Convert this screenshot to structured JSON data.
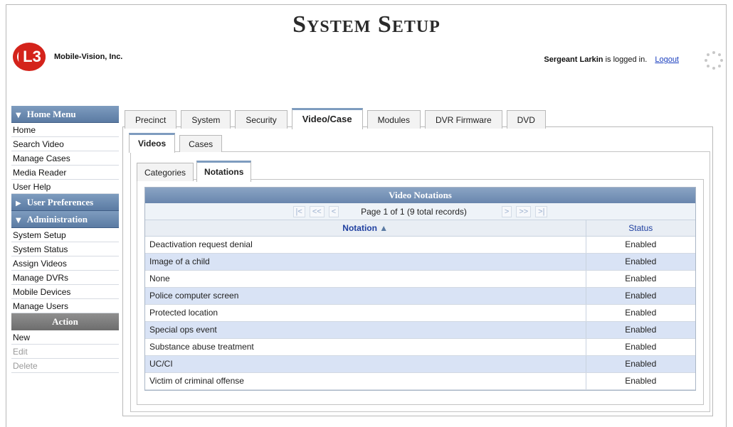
{
  "header": {
    "title": "System Setup",
    "company": "Mobile-Vision, Inc.",
    "logo_mark": "L3",
    "user_name": "Sergeant Larkin",
    "logged_in_text": "is logged in.",
    "logout_label": "Logout"
  },
  "sidebar": {
    "home_menu": {
      "header": "Home Menu",
      "items": [
        "Home",
        "Search Video",
        "Manage Cases",
        "Media Reader",
        "User Help"
      ]
    },
    "user_prefs": {
      "header": "User Preferences"
    },
    "administration": {
      "header": "Administration",
      "items": [
        "System Setup",
        "System Status",
        "Assign Videos",
        "Manage DVRs",
        "Mobile Devices",
        "Manage Users"
      ]
    },
    "action": {
      "header": "Action",
      "items": [
        {
          "label": "New",
          "enabled": true
        },
        {
          "label": "Edit",
          "enabled": false
        },
        {
          "label": "Delete",
          "enabled": false
        }
      ]
    }
  },
  "main_tabs": [
    "Precinct",
    "System",
    "Security",
    "Video/Case",
    "Modules",
    "DVR Firmware",
    "DVD"
  ],
  "main_tab_active": "Video/Case",
  "sub_tabs": [
    "Videos",
    "Cases"
  ],
  "sub_tab_active": "Videos",
  "sub_sub_tabs": [
    "Categories",
    "Notations"
  ],
  "sub_sub_tab_active": "Notations",
  "grid": {
    "title": "Video Notations",
    "pager_text": "Page 1 of 1 (9 total records)",
    "pager_first": "|<",
    "pager_prev_page": "<<",
    "pager_prev": "<",
    "pager_next": ">",
    "pager_next_page": ">>",
    "pager_last": ">|",
    "col_notation": "Notation",
    "sort_arrow": "▲",
    "col_status": "Status",
    "rows": [
      {
        "notation": "Deactivation request denial",
        "status": "Enabled"
      },
      {
        "notation": "Image of a child",
        "status": "Enabled"
      },
      {
        "notation": "None",
        "status": "Enabled"
      },
      {
        "notation": "Police computer screen",
        "status": "Enabled"
      },
      {
        "notation": "Protected location",
        "status": "Enabled"
      },
      {
        "notation": "Special ops event",
        "status": "Enabled"
      },
      {
        "notation": "Substance abuse treatment",
        "status": "Enabled"
      },
      {
        "notation": "UC/CI",
        "status": "Enabled"
      },
      {
        "notation": "Victim of criminal offense",
        "status": "Enabled"
      }
    ]
  },
  "colors": {
    "accent": "#7e9cbf",
    "header_blue": "#6986ad",
    "alt_row": "#d9e3f5",
    "link": "#1a3fbf",
    "logo_red": "#d4231b"
  }
}
